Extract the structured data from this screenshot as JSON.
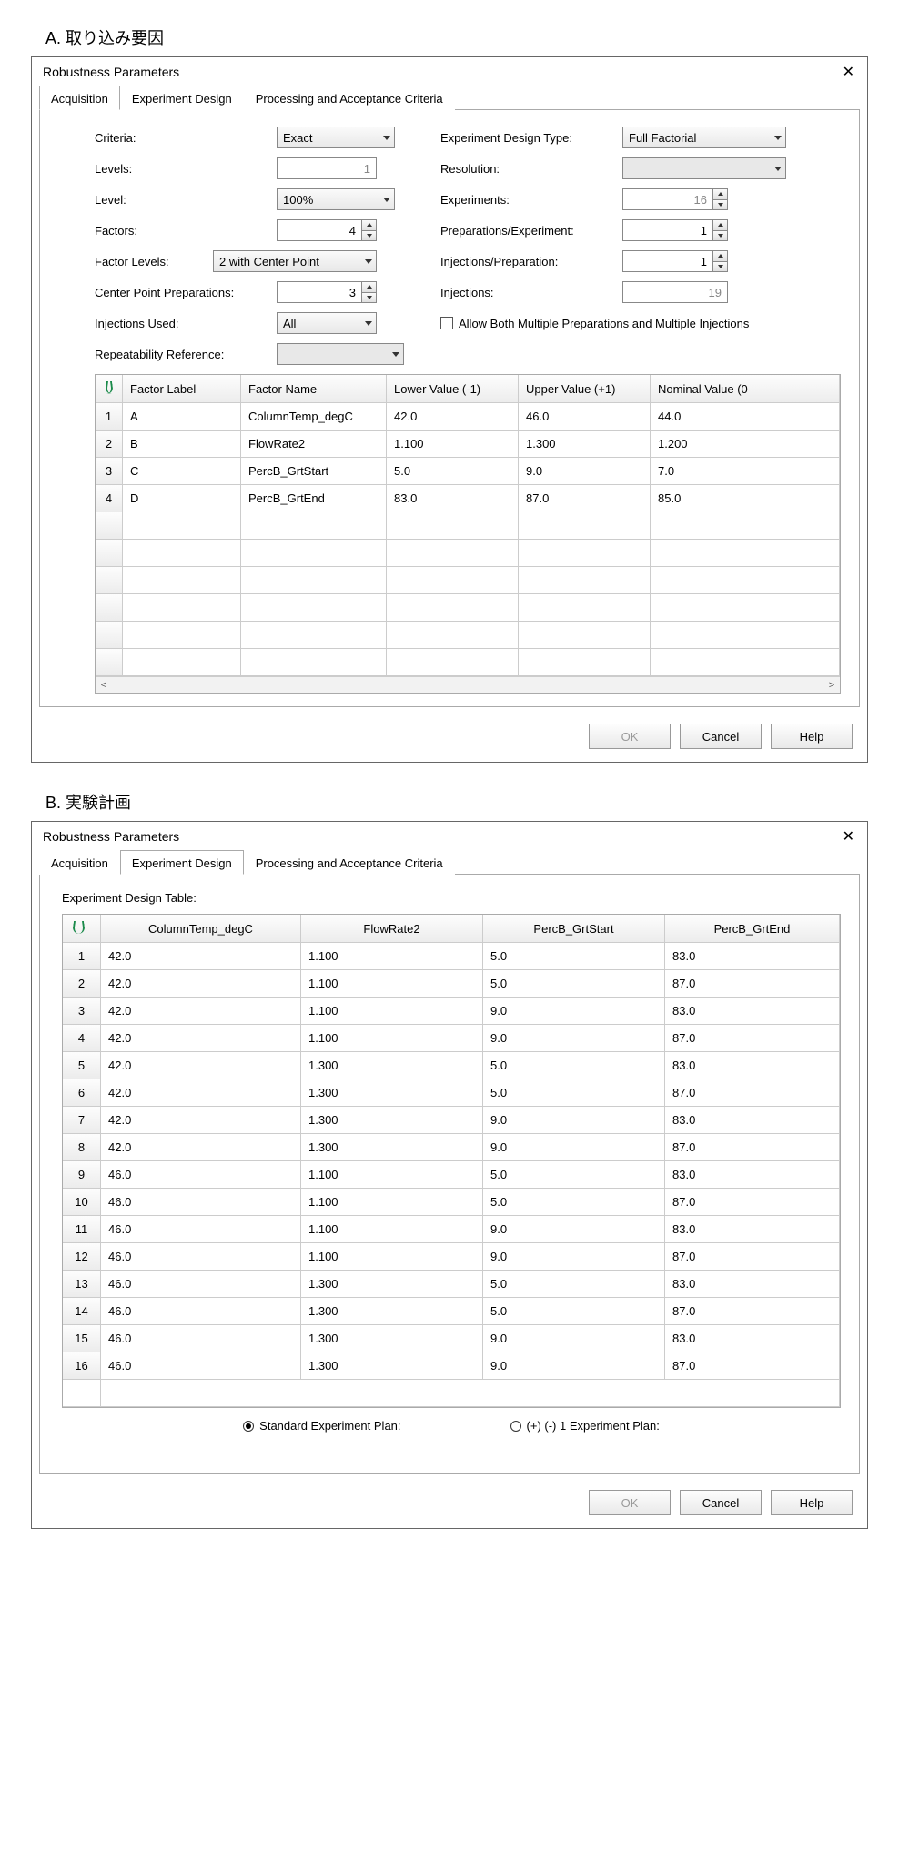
{
  "sectionA": {
    "heading": "A. 取り込み要因"
  },
  "sectionB": {
    "heading": "B. 実験計画"
  },
  "dialog": {
    "title": "Robustness Parameters",
    "tabs": {
      "acq": "Acquisition",
      "exp": "Experiment Design",
      "proc": "Processing and Acceptance Criteria"
    },
    "buttons": {
      "ok": "OK",
      "cancel": "Cancel",
      "help": "Help"
    }
  },
  "acq": {
    "labels": {
      "criteria": "Criteria:",
      "levelsN": "Levels:",
      "level": "Level:",
      "factors": "Factors:",
      "factorLevels": "Factor Levels:",
      "centerPrep": "Center Point Preparations:",
      "injUsed": "Injections Used:",
      "repRef": "Repeatability Reference:",
      "expType": "Experiment Design Type:",
      "resolution": "Resolution:",
      "experiments": "Experiments:",
      "prepPerExp": "Preparations/Experiment:",
      "injPerPrep": "Injections/Preparation:",
      "injections": "Injections:",
      "allowBoth": "Allow Both Multiple Preparations and Multiple Injections"
    },
    "values": {
      "criteria": "Exact",
      "levelsN": "1",
      "level": "100%",
      "factors": "4",
      "factorLevels": "2 with Center Point",
      "centerPrep": "3",
      "injUsed": "All",
      "expType": "Full Factorial",
      "resolution": "",
      "experiments": "16",
      "prepPerExp": "1",
      "injPerPrep": "1",
      "injections": "19"
    },
    "grid": {
      "headers": {
        "label": "Factor Label",
        "name": "Factor Name",
        "low": "Lower Value (-1)",
        "high": "Upper Value (+1)",
        "nom": "Nominal Value (0"
      },
      "rows": [
        {
          "label": "A",
          "name": "ColumnTemp_degC",
          "low": "42.0",
          "high": "46.0",
          "nom": "44.0"
        },
        {
          "label": "B",
          "name": "FlowRate2",
          "low": "1.100",
          "high": "1.300",
          "nom": "1.200"
        },
        {
          "label": "C",
          "name": "PercB_GrtStart",
          "low": "5.0",
          "high": "9.0",
          "nom": "7.0"
        },
        {
          "label": "D",
          "name": "PercB_GrtEnd",
          "low": "83.0",
          "high": "87.0",
          "nom": "85.0"
        }
      ]
    }
  },
  "expd": {
    "tableLabel": "Experiment Design Table:",
    "headers": {
      "c1": "ColumnTemp_degC",
      "c2": "FlowRate2",
      "c3": "PercB_GrtStart",
      "c4": "PercB_GrtEnd"
    },
    "rows": [
      {
        "c1": "42.0",
        "c2": "1.100",
        "c3": "5.0",
        "c4": "83.0"
      },
      {
        "c1": "42.0",
        "c2": "1.100",
        "c3": "5.0",
        "c4": "87.0"
      },
      {
        "c1": "42.0",
        "c2": "1.100",
        "c3": "9.0",
        "c4": "83.0"
      },
      {
        "c1": "42.0",
        "c2": "1.100",
        "c3": "9.0",
        "c4": "87.0"
      },
      {
        "c1": "42.0",
        "c2": "1.300",
        "c3": "5.0",
        "c4": "83.0"
      },
      {
        "c1": "42.0",
        "c2": "1.300",
        "c3": "5.0",
        "c4": "87.0"
      },
      {
        "c1": "42.0",
        "c2": "1.300",
        "c3": "9.0",
        "c4": "83.0"
      },
      {
        "c1": "42.0",
        "c2": "1.300",
        "c3": "9.0",
        "c4": "87.0"
      },
      {
        "c1": "46.0",
        "c2": "1.100",
        "c3": "5.0",
        "c4": "83.0"
      },
      {
        "c1": "46.0",
        "c2": "1.100",
        "c3": "5.0",
        "c4": "87.0"
      },
      {
        "c1": "46.0",
        "c2": "1.100",
        "c3": "9.0",
        "c4": "83.0"
      },
      {
        "c1": "46.0",
        "c2": "1.100",
        "c3": "9.0",
        "c4": "87.0"
      },
      {
        "c1": "46.0",
        "c2": "1.300",
        "c3": "5.0",
        "c4": "83.0"
      },
      {
        "c1": "46.0",
        "c2": "1.300",
        "c3": "5.0",
        "c4": "87.0"
      },
      {
        "c1": "46.0",
        "c2": "1.300",
        "c3": "9.0",
        "c4": "83.0"
      },
      {
        "c1": "46.0",
        "c2": "1.300",
        "c3": "9.0",
        "c4": "87.0"
      }
    ],
    "radios": {
      "std": "Standard Experiment Plan:",
      "pm": "(+) (-) 1 Experiment Plan:"
    }
  }
}
